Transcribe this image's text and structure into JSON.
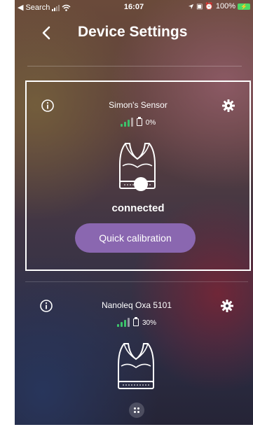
{
  "status_bar": {
    "back_app": "Search",
    "time": "16:07",
    "battery": "100%"
  },
  "header": {
    "title": "Device Settings",
    "back_icon": "chevron-left-icon"
  },
  "devices": [
    {
      "name": "Simon's Sensor",
      "battery": "0%",
      "status": "connected",
      "action_label": "Quick calibration",
      "selected": true
    },
    {
      "name": "Nanoleq Oxa 5101",
      "battery": "30%",
      "selected": false
    }
  ],
  "colors": {
    "accent_button": "#8a67b0",
    "signal": "#3cc26b",
    "selection_border": "#ffffff"
  }
}
